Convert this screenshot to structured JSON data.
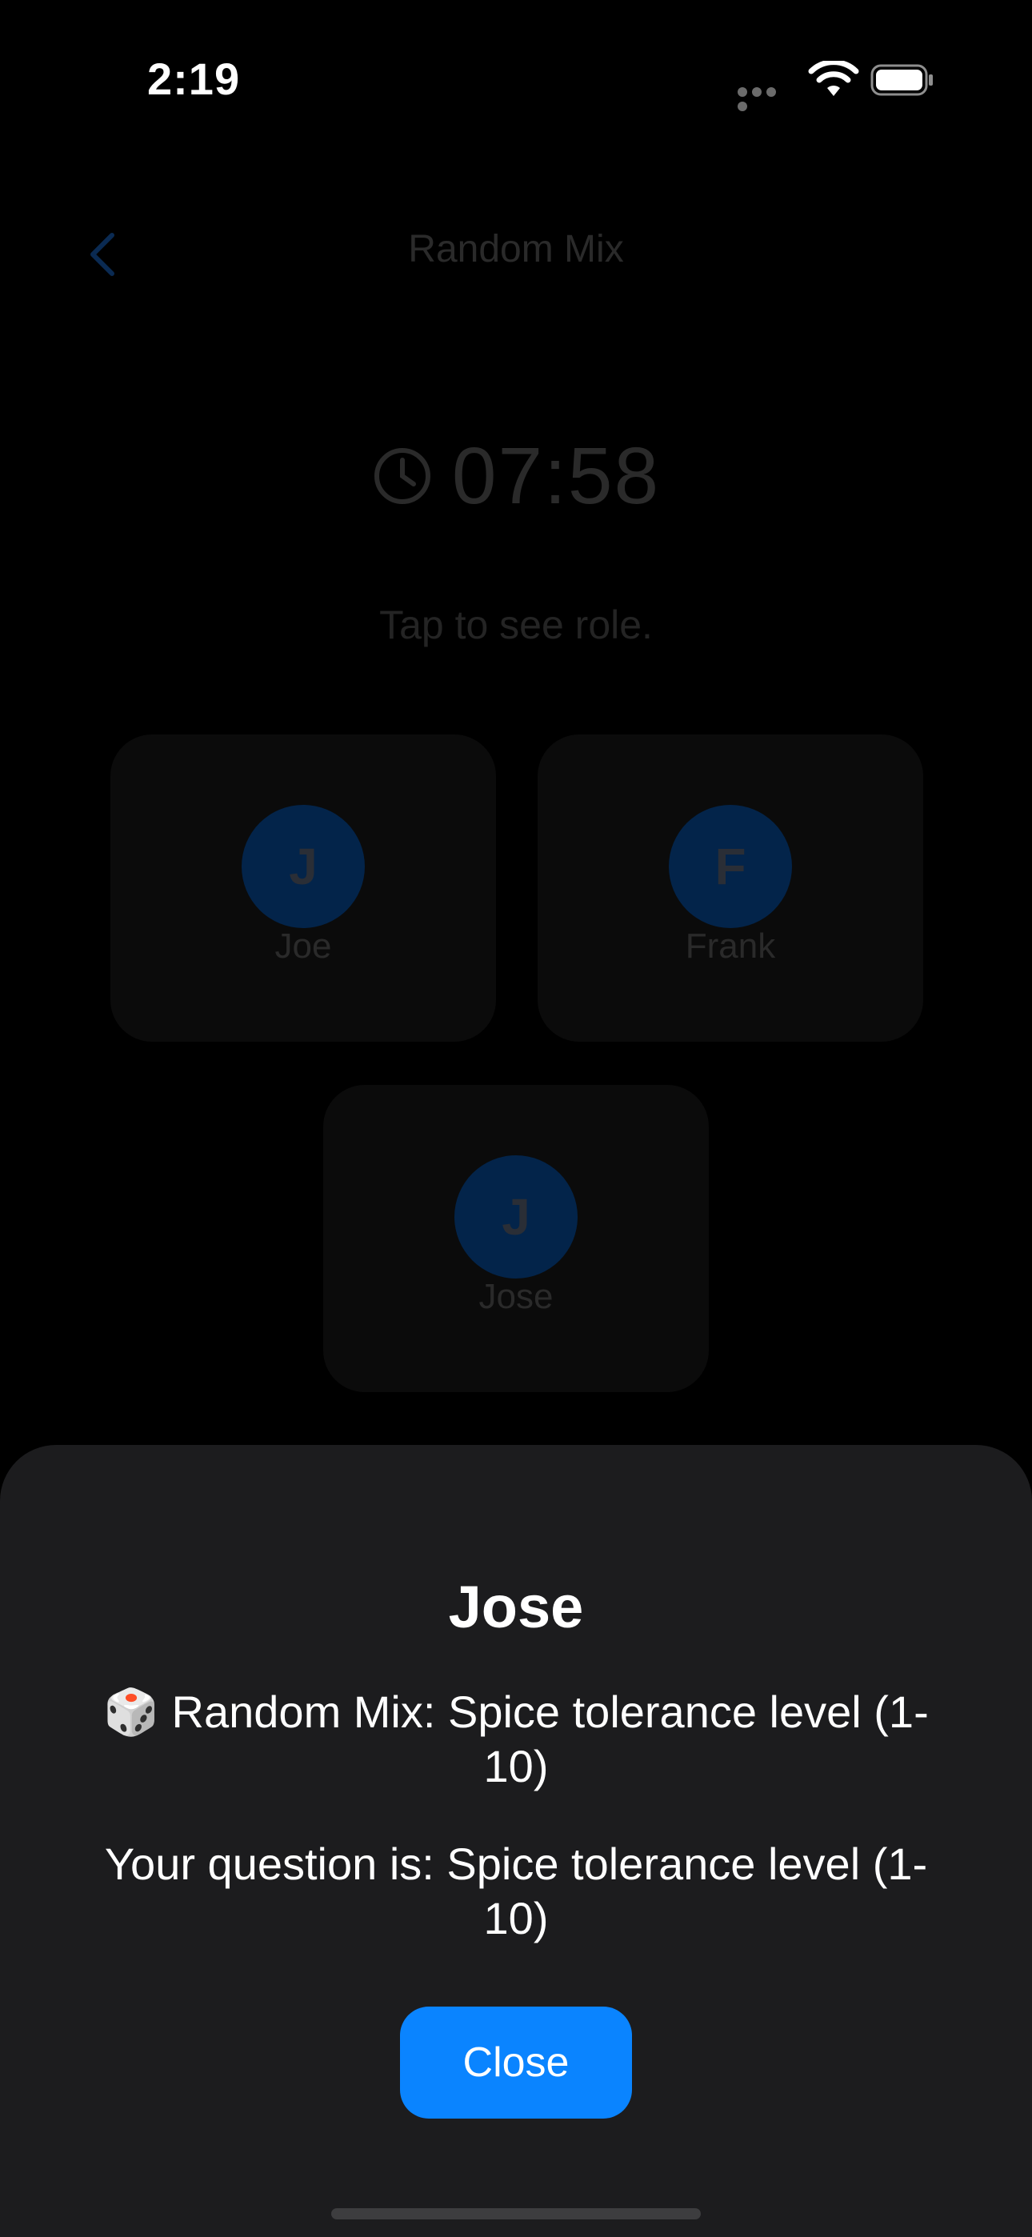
{
  "status_bar": {
    "time": "2:19"
  },
  "nav": {
    "title": "Random Mix",
    "back_icon": "chevron-left-icon",
    "accent_color": "#0a84ff"
  },
  "timer": {
    "icon": "clock-icon",
    "value": "07:58"
  },
  "hint": "Tap to see role.",
  "players": [
    {
      "initial": "J",
      "name": "Joe"
    },
    {
      "initial": "F",
      "name": "Frank"
    },
    {
      "initial": "J",
      "name": "Jose"
    }
  ],
  "sheet": {
    "title": "Jose",
    "category_emoji": "🎲",
    "category_text": "Random Mix: Spice tolerance level (1-10)",
    "question_text": "Your question is: Spice tolerance level (1-10)",
    "close_label": "Close"
  }
}
